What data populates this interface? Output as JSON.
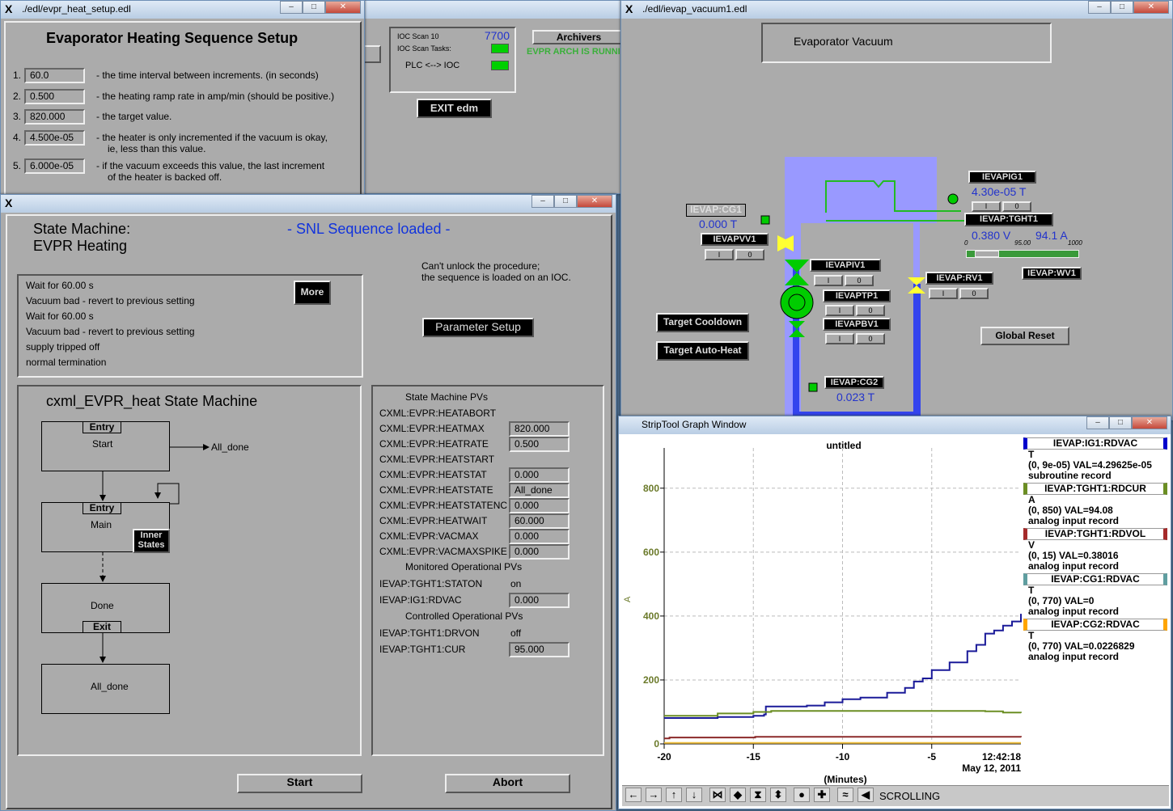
{
  "setup_window": {
    "title": "./edl/evpr_heat_setup.edl",
    "heading": "Evaporator Heating Sequence Setup",
    "params": [
      {
        "num": "1.",
        "value": "60.0",
        "desc": [
          "- the time interval between increments. (in seconds)"
        ]
      },
      {
        "num": "2.",
        "value": "0.500",
        "desc": [
          "- the heating ramp rate in amp/min (should be positive.)"
        ]
      },
      {
        "num": "3.",
        "value": "820.000",
        "desc": [
          "- the target value."
        ]
      },
      {
        "num": "4.",
        "value": "4.500e-05",
        "desc": [
          "- the heater is only incremented if the vacuum is okay,",
          "ie, less than this value."
        ]
      },
      {
        "num": "5.",
        "value": "6.000e-05",
        "desc": [
          "- if the vacuum exceeds this value, the last increment",
          "of the heater is backed off."
        ]
      }
    ]
  },
  "edm_main": {
    "ioc_scan_label": "IOC Scan 10",
    "ioc_scan_value": "7700",
    "ioc_scan_tasks": "IOC Scan Tasks:",
    "plc_ioc": "PLC <--> IOC",
    "archivers": "Archivers",
    "arch_status": "EVPR ARCH IS RUNNIN",
    "exit": "EXIT edm",
    "led_color": "#00d000"
  },
  "state_window": {
    "title1": "State Machine:",
    "title2": "EVPR Heating",
    "status": "- SNL Sequence loaded -",
    "note": [
      "Can't unlock the procedure;",
      "the sequence is loaded on an IOC."
    ],
    "log": [
      "Wait for    60.00 s",
      "Vacuum bad - revert to previous setting",
      "Wait for    60.00 s",
      "Vacuum bad - revert to previous setting",
      "supply tripped off",
      "normal termination"
    ],
    "more": "More",
    "param_setup": "Parameter Setup",
    "diagram_title": "cxml_EVPR_heat State Machine",
    "states": {
      "start": "Start",
      "entry": "Entry",
      "main": "Main",
      "inner": "Inner States",
      "done": "Done",
      "exit": "Exit",
      "all_done": "All_done",
      "all_done_arrow": "All_done"
    },
    "pv_header": "State Machine PVs",
    "pvs": [
      {
        "name": "CXML:EVPR:HEATABORT",
        "value": null
      },
      {
        "name": "CXML:EVPR:HEATMAX",
        "value": "820.000"
      },
      {
        "name": "CXML:EVPR:HEATRATE",
        "value": "0.500"
      },
      {
        "name": "CXML:EVPR:HEATSTART",
        "value": null
      },
      {
        "name": "CXML:EVPR:HEATSTAT",
        "value": "0.000"
      },
      {
        "name": "CXML:EVPR:HEATSTATE",
        "value": "All_done"
      },
      {
        "name": "CXML:EVPR:HEATSTATENC",
        "value": "0.000"
      },
      {
        "name": "CXML:EVPR:HEATWAIT",
        "value": "60.000"
      },
      {
        "name": "CXML:EVPR:VACMAX",
        "value": "0.000"
      },
      {
        "name": "CXML:EVPR:VACMAXSPIKE",
        "value": "0.000"
      }
    ],
    "mon_header": "Monitored Operational PVs",
    "mon": [
      {
        "name": "IEVAP:TGHT1:STATON",
        "text": "on"
      },
      {
        "name": "IEVAP:IG1:RDVAC",
        "value": "0.000"
      }
    ],
    "ctl_header": "Controlled Operational PVs",
    "ctl": [
      {
        "name": "IEVAP:TGHT1:DRVON",
        "text": "off"
      },
      {
        "name": "IEVAP:TGHT1:CUR",
        "value": "95.000"
      }
    ],
    "start": "Start",
    "abort": "Abort"
  },
  "vacuum_window": {
    "title": "./edl/ievap_vacuum1.edl",
    "heading": "Evaporator Vacuum",
    "cg1": "IEVAP:CG1",
    "cg1_val": "0.000 T",
    "pvv1": "IEVAPVV1",
    "piv1": "IEVAPIV1",
    "ptp1": "IEVAPTP1",
    "pbv1": "IEVAPBV1",
    "cg2": "IEVAP:CG2",
    "cg2_val": "0.023 T",
    "ig1": "IEVAPIG1",
    "ig1_val": "4.30e-05 T",
    "tght1": "IEVAP:TGHT1",
    "tght1_v": "0.380 V",
    "tght1_a": "94.1 A",
    "slider_min": "0",
    "slider_set": "95.00",
    "slider_max": "1000",
    "slider_fraction": 0.095,
    "rv1": "IEVAP:RV1",
    "wv1": "IEVAP:WV1",
    "on": "I",
    "off": "0",
    "cooldown": "Target Cooldown",
    "autoheat": "Target Auto-Heat",
    "reset": "Global Reset",
    "colors": {
      "chamber": "#9999ff",
      "pipe": "#3344ee",
      "ok": "#00cc00",
      "valve": "#ffff33"
    }
  },
  "striptool": {
    "title": "StripTool Graph Window",
    "mode": "SCROLLING",
    "legend": [
      {
        "name": "IEVAP:IG1:RDVAC",
        "unit": "T",
        "range": "(0, 9e-05) VAL=4.29625e-05",
        "rec": "subroutine record",
        "color": "#0000cc"
      },
      {
        "name": "IEVAP:TGHT1:RDCUR",
        "unit": "A",
        "range": "(0, 850) VAL=94.08",
        "rec": "analog input record",
        "color": "#6b8e23"
      },
      {
        "name": "IEVAP:TGHT1:RDVOL",
        "unit": "V",
        "range": "(0, 15) VAL=0.38016",
        "rec": "analog input record",
        "color": "#a52a2a"
      },
      {
        "name": "IEVAP:CG1:RDVAC",
        "unit": "T",
        "range": "(0, 770)  VAL=0",
        "rec": "analog input record",
        "color": "#5f9ea0"
      },
      {
        "name": "IEVAP:CG2:RDVAC",
        "unit": "T",
        "range": "(0, 770) VAL=0.0226829",
        "rec": "analog input record",
        "color": "#ffa500"
      }
    ]
  },
  "chart_data": {
    "type": "line",
    "title": "untitled",
    "xlabel": "(Minutes)",
    "ylabel": "A",
    "xlim": [
      -20,
      0
    ],
    "ylim": [
      0,
      850
    ],
    "xticks": [
      "-20",
      "-15",
      "-10",
      "-5"
    ],
    "yticks": [
      "0",
      "200",
      "400",
      "600",
      "800"
    ],
    "time_label": "12:42:18",
    "date_label": "May 12, 2011",
    "grid": true,
    "series": [
      {
        "name": "IEVAP:IG1:RDVAC",
        "color": "#1a1a99",
        "x": [
          -20,
          -17,
          -15,
          -14.4,
          -14.3,
          -12,
          -11,
          -10,
          -9,
          -7.5,
          -6.5,
          -6,
          -5.5,
          -5,
          -4,
          -3,
          -2.5,
          -2,
          -1.5,
          -1,
          -0.5,
          0
        ],
        "y": [
          81,
          84,
          88,
          92,
          117,
          120,
          130,
          140,
          145,
          160,
          175,
          195,
          205,
          231,
          255,
          290,
          310,
          345,
          355,
          370,
          383,
          407
        ]
      },
      {
        "name": "IEVAP:TGHT1:RDCUR",
        "color": "#6b8e23",
        "x": [
          -20,
          -17,
          -15,
          -14,
          -10,
          -5,
          -2,
          -1,
          0
        ],
        "y": [
          88,
          95,
          100,
          103,
          103,
          103,
          102,
          98,
          97
        ]
      },
      {
        "name": "IEVAP:TGHT1:RDVOL",
        "color": "#8b2a2a",
        "x": [
          -20,
          -19.7,
          -15,
          -14.9,
          -5,
          -1.5,
          0
        ],
        "y": [
          17,
          20,
          20,
          22,
          22,
          22,
          21
        ]
      },
      {
        "name": "IEVAP:CG2:RDVAC",
        "color": "#f0c040",
        "x": [
          -20,
          0
        ],
        "y": [
          3,
          3
        ]
      }
    ]
  }
}
